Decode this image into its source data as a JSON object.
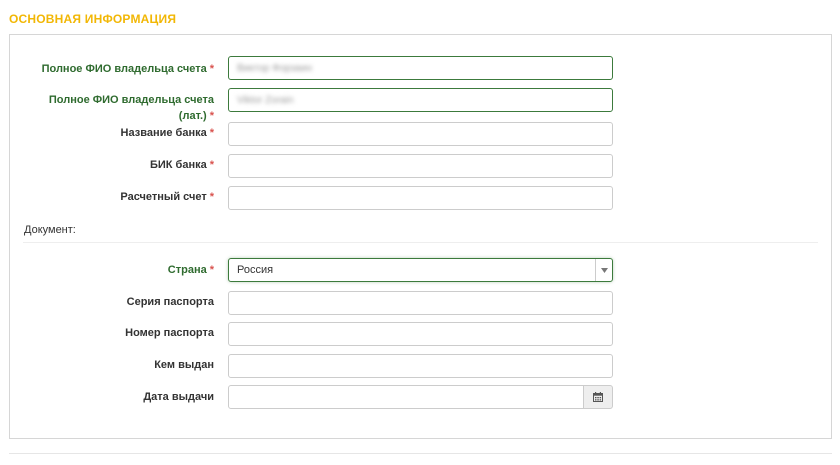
{
  "section": {
    "title": "ОСНОВНАЯ ИНФОРМАЦИЯ"
  },
  "required_mark": "*",
  "fields": {
    "owner_name": {
      "label": "Полное ФИО владельца счета",
      "value": "Виктор Форзаин"
    },
    "owner_name_lat": {
      "label_line1": "Полное ФИО владельца счета",
      "label_line2": "(лат.)",
      "value": "Viktor Zorain"
    },
    "bank_name": {
      "label": "Название банка",
      "value": ""
    },
    "bik": {
      "label": "БИК банка",
      "value": ""
    },
    "account": {
      "label": "Расчетный счет",
      "value": ""
    }
  },
  "document": {
    "heading": "Документ:",
    "country": {
      "label": "Страна",
      "selected": "Россия"
    },
    "passport_series": {
      "label": "Серия паспорта",
      "value": ""
    },
    "passport_number": {
      "label": "Номер паспорта",
      "value": ""
    },
    "issued_by": {
      "label": "Кем выдан",
      "value": ""
    },
    "issue_date": {
      "label": "Дата выдачи",
      "value": ""
    }
  },
  "colors": {
    "section_title": "#f2b705",
    "label_green": "#2f6b2f",
    "required": "#d9534f",
    "focus_border": "#3c7a3c"
  },
  "icons": {
    "calendar": "calendar-icon",
    "dropdown": "chevron-down-icon"
  }
}
